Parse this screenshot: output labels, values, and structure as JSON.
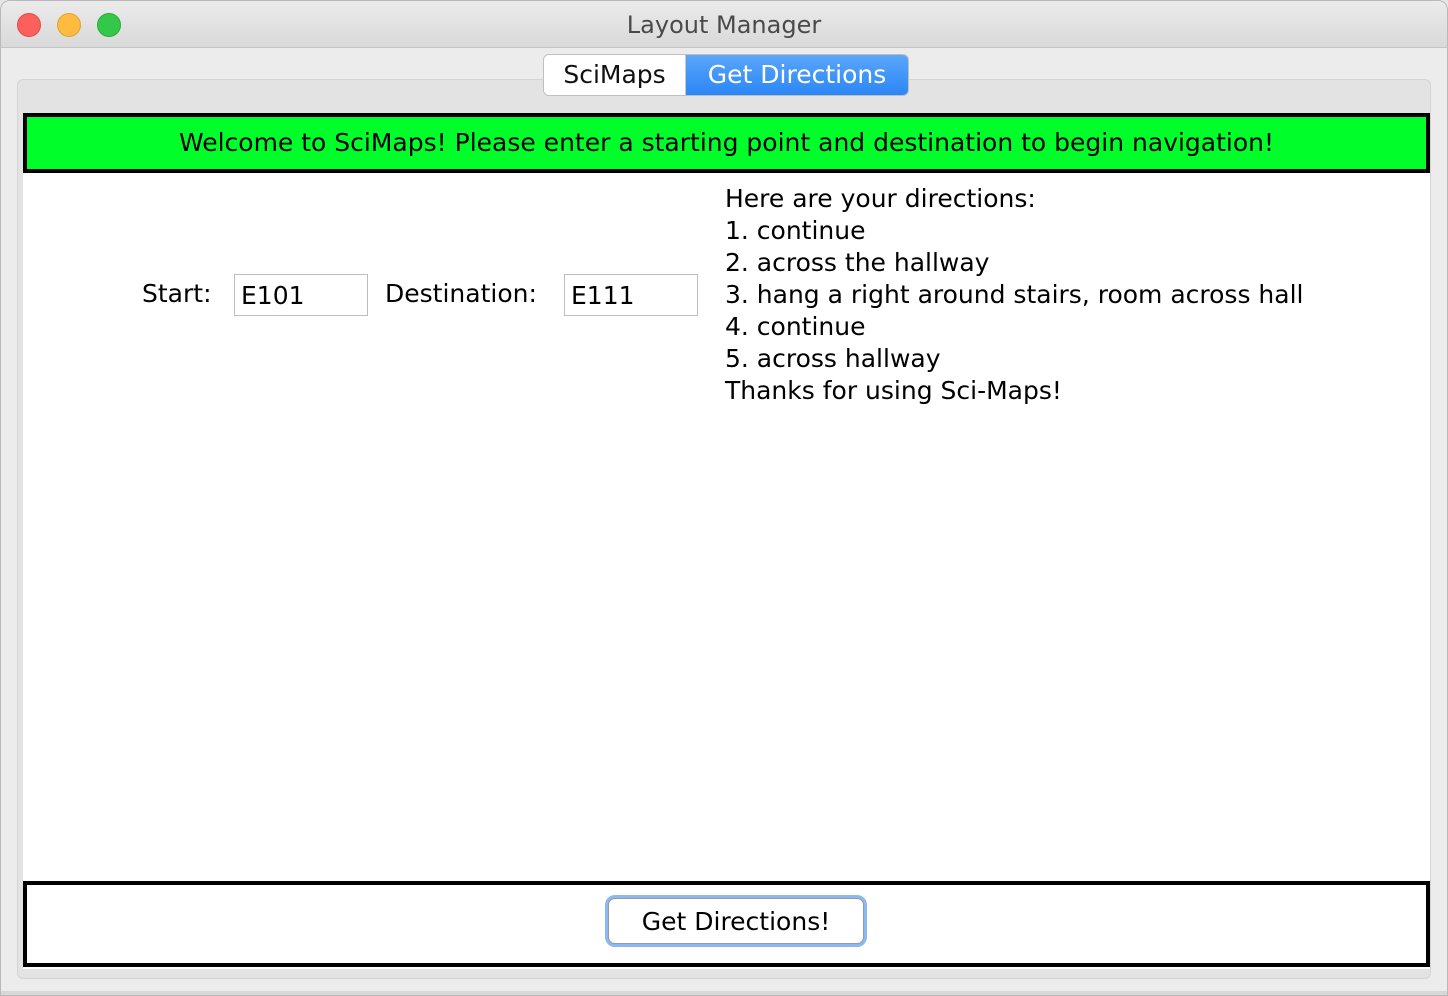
{
  "window": {
    "title": "Layout Manager"
  },
  "tabs": [
    {
      "label": "SciMaps",
      "selected": false
    },
    {
      "label": "Get Directions",
      "selected": true
    }
  ],
  "banner": {
    "text": "Welcome to SciMaps! Please enter a starting point and destination to begin navigation!",
    "color": "#00ff2a"
  },
  "form": {
    "start_label": "Start:",
    "start_value": "E101",
    "destination_label": "Destination:",
    "destination_value": "E111"
  },
  "directions": {
    "header": "Here are your directions:",
    "steps": [
      "1. continue",
      "2. across the hallway",
      "3. hang a right around stairs, room across hall",
      "4. continue",
      "5. across hallway"
    ],
    "footer": "Thanks for using Sci-Maps!"
  },
  "action": {
    "button_label": "Get Directions!"
  },
  "colors": {
    "accent": "#2b86f5",
    "close": "#fc605c",
    "minimize": "#fdbc40",
    "maximize": "#34c84a"
  }
}
